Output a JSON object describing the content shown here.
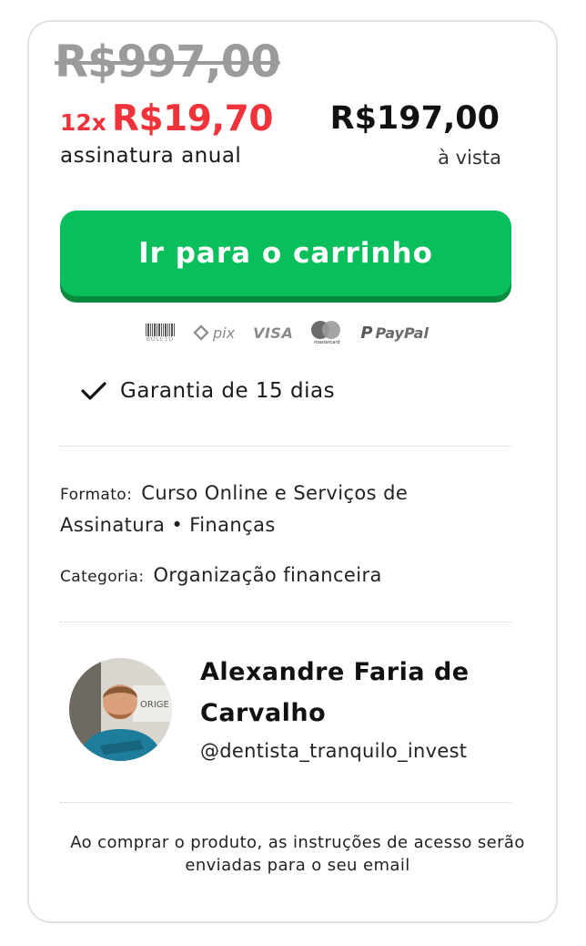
{
  "pricing": {
    "old_price": "R$997,00",
    "installment_count": "12x",
    "installment_amount": "R$19,70",
    "plan_label": "assinatura anual",
    "cash_price": "R$197,00",
    "cash_label": "à vista"
  },
  "cta": {
    "label": "Ir para o carrinho",
    "color": "#08bf5b"
  },
  "payment_methods": {
    "boleto": "BOLETO",
    "pix": "pix",
    "visa": "VISA",
    "mastercard": "mastercard",
    "paypal": "PayPal"
  },
  "guarantee": {
    "text": "Garantia de 15 dias",
    "icon": "check-icon"
  },
  "details": {
    "format_label": "Formato:",
    "format_value": "Curso Online e Serviços de Assinatura • Finanças",
    "category_label": "Categoria:",
    "category_value": "Organização financeira"
  },
  "author": {
    "name": "Alexandre Faria de Carvalho",
    "handle": "@dentista_tranquilo_invest"
  },
  "footnote": "Ao comprar o produto, as instruções de acesso serão enviadas para o seu email",
  "colors": {
    "accent_red": "#f0333a",
    "button_green": "#08bf5b",
    "button_shadow": "#0a8a3f"
  }
}
